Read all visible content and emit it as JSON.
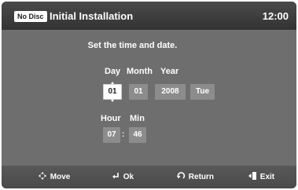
{
  "header": {
    "badge": "No Disc",
    "title": "Initial Installation",
    "clock": "12:00"
  },
  "main": {
    "prompt": "Set the time and date.",
    "date": {
      "labels": {
        "day": "Day",
        "month": "Month",
        "year": "Year"
      },
      "values": {
        "day": "01",
        "month": "01",
        "year": "2008",
        "weekday": "Tue"
      }
    },
    "time": {
      "labels": {
        "hour": "Hour",
        "min": "Min"
      },
      "values": {
        "hour": "07",
        "min": "46"
      },
      "separator": ":"
    },
    "selected_field": "day"
  },
  "footer": {
    "move": {
      "icon": "move-arrows-icon",
      "label": "Move"
    },
    "ok": {
      "icon": "enter-icon",
      "label": "Ok"
    },
    "return": {
      "icon": "return-arrow-icon",
      "label": "Return"
    },
    "exit": {
      "icon": "exit-door-icon",
      "label": "Exit"
    }
  },
  "colors": {
    "background": "#6e6e6e",
    "titlebar": "#3a3a3a",
    "field": "#8c8c8c",
    "selected_field": "#ffffff",
    "text": "#ffffff"
  }
}
